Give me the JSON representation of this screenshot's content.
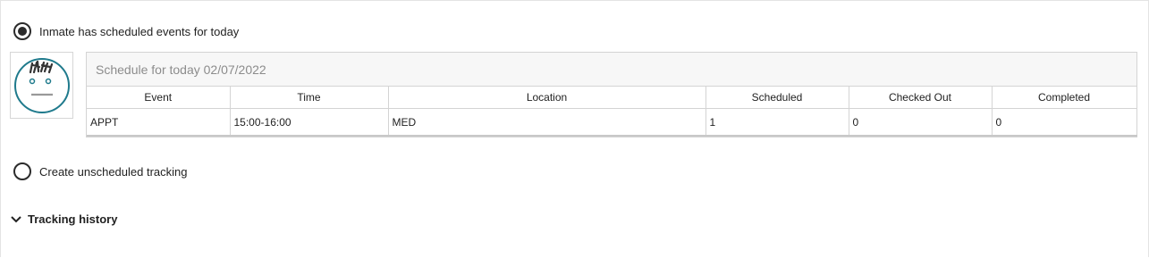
{
  "options": {
    "scheduled_label": "Inmate has scheduled events for today",
    "unscheduled_label": "Create unscheduled tracking",
    "selected": "scheduled"
  },
  "avatar": {
    "icon": "placeholder-face-icon",
    "color": "#1f7a8c"
  },
  "schedule": {
    "title": "Schedule for today 02/07/2022",
    "columns": [
      "Event",
      "Time",
      "Location",
      "Scheduled",
      "Checked Out",
      "Completed"
    ],
    "rows": [
      {
        "event": "APPT",
        "time": "15:00-16:00",
        "location": "MED",
        "scheduled": "1",
        "checked_out": "0",
        "completed": "0"
      }
    ]
  },
  "history": {
    "label": "Tracking history",
    "icon": "chevron-down-icon"
  }
}
